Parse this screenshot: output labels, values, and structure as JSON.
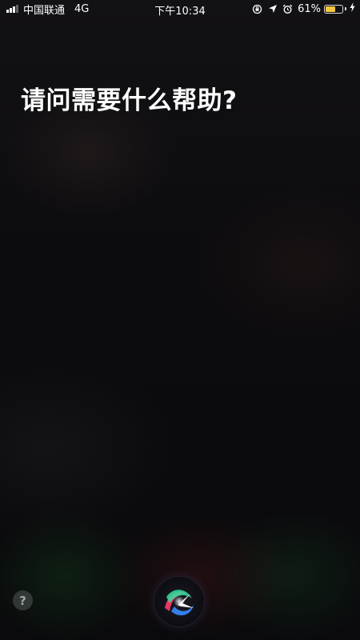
{
  "status_bar": {
    "carrier": "中国联通",
    "network": "4G",
    "time": "下午10:34",
    "battery_percent_label": "61%",
    "battery_level": 0.61,
    "battery_color": "#f7c73b",
    "icons": [
      "signal-icon",
      "orientation-lock-icon",
      "location-icon",
      "alarm-icon",
      "battery-icon",
      "charging-icon"
    ]
  },
  "siri": {
    "prompt": "请问需要什么帮助?",
    "help_label": "?",
    "orb_colors": [
      "#ff3b6b",
      "#34e0a1",
      "#3a8bff",
      "#ffffff"
    ]
  }
}
